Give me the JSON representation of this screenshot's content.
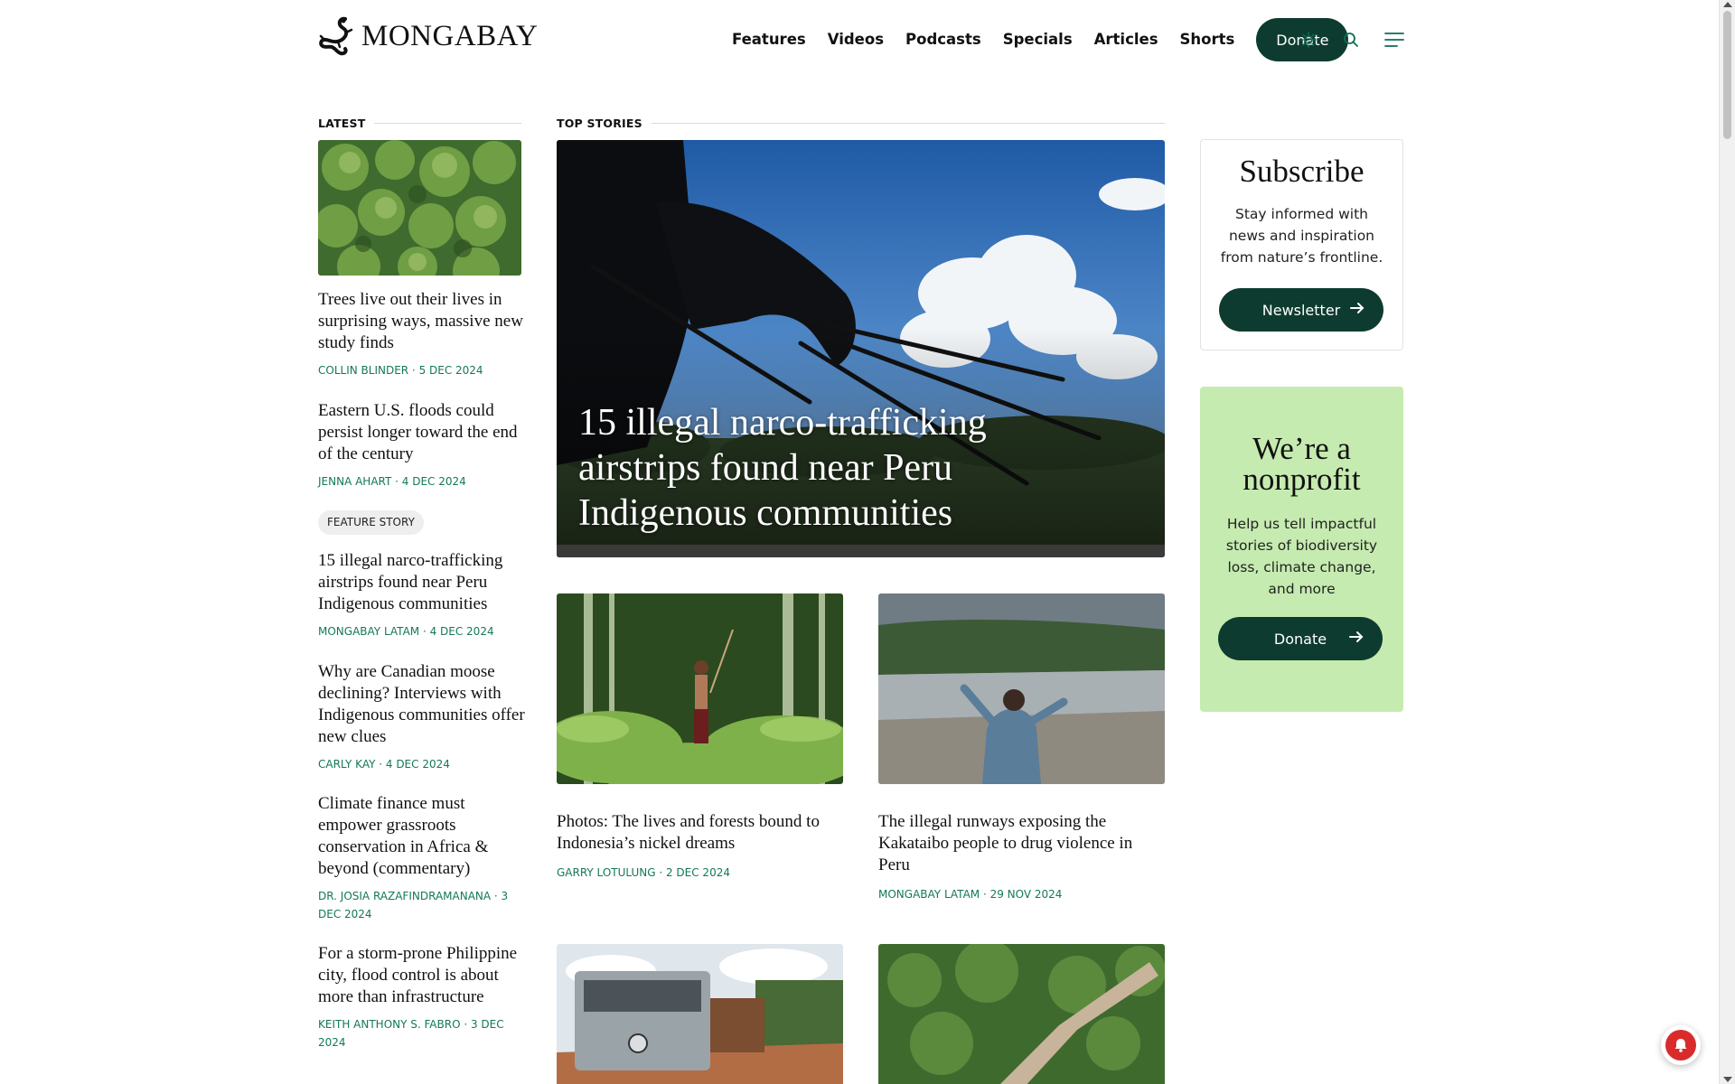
{
  "header": {
    "logo_text": "MONGABAY",
    "nav": [
      "Features",
      "Videos",
      "Podcasts",
      "Specials",
      "Articles",
      "Shorts"
    ],
    "donate_label": "Donate"
  },
  "latest": {
    "heading": "LATEST",
    "stories": [
      {
        "title": "Trees live out their lives in surprising ways, massive new study finds",
        "byline": "COLLIN BLINDER · 5 DEC 2024"
      },
      {
        "title": "Eastern U.S. floods could persist longer toward the end of the century",
        "byline": "JENNA AHART · 4 DEC 2024"
      },
      {
        "title": "15 illegal narco-trafficking airstrips found near Peru Indigenous communities",
        "byline": "MONGABAY LATAM · 4 DEC 2024"
      },
      {
        "title": "Why are Canadian moose declining? Interviews with Indigenous communities offer new clues",
        "byline": "CARLY KAY · 4 DEC 2024"
      },
      {
        "title": "Climate finance must empower grassroots conservation in Africa & beyond (commentary)",
        "byline": "DR. JOSIA RAZAFINDRAMANANA · 3 DEC 2024"
      },
      {
        "title": "For a storm-prone Philippine city, flood control is about more than infrastructure",
        "byline": "KEITH ANTHONY S. FABRO · 3 DEC 2024"
      }
    ],
    "feature_pill": "FEATURE STORY"
  },
  "top": {
    "heading": "TOP STORIES",
    "hero_title": "15 illegal narco-trafficking airstrips found near Peru Indigenous communities",
    "cards": [
      {
        "title": "Photos: The lives and forests bound to Indonesia’s nickel dreams",
        "byline": "GARRY LOTULUNG · 2 DEC 2024"
      },
      {
        "title": "The illegal runways exposing the Kakataibo people to drug violence in Peru",
        "byline": "MONGABAY LATAM · 29 NOV 2024"
      }
    ]
  },
  "subscribe": {
    "title": "Subscribe",
    "text": "Stay informed with news and inspiration from nature’s frontline.",
    "button": "Newsletter"
  },
  "nonprofit": {
    "title": "We’re a nonprofit",
    "text": "Help us tell impactful stories of biodiversity loss, climate change, and more",
    "button": "Donate"
  },
  "colors": {
    "accent": "#0e3b2f",
    "byline": "#137a52",
    "nonprofit_bg": "#c5ebb0"
  }
}
